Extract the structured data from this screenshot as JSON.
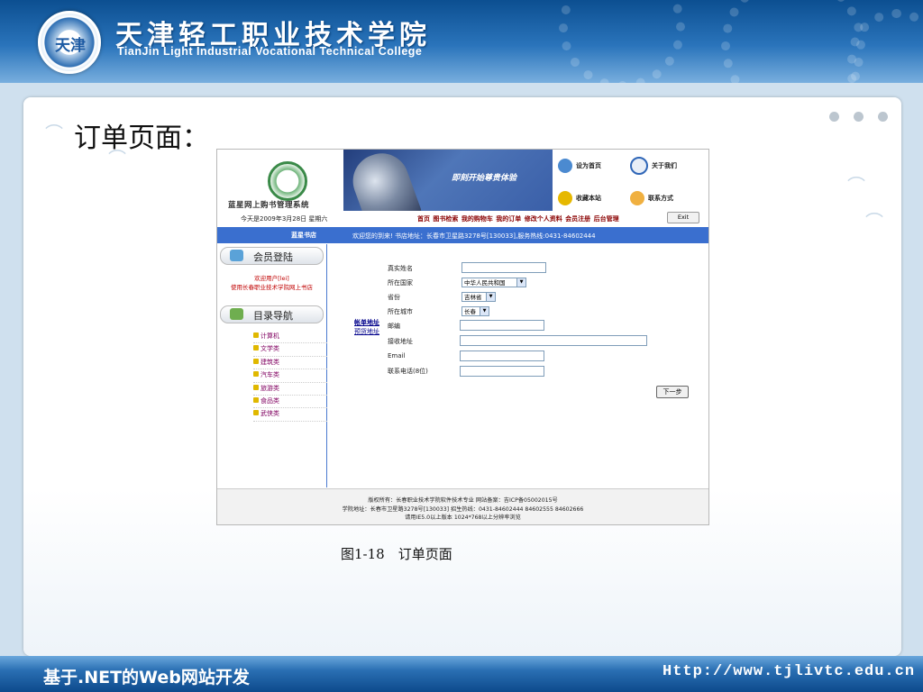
{
  "header": {
    "logo_text": "天津",
    "college_cn": "天津轻工职业技术学院",
    "college_en": "TianJin Light Industrial Vocational Technical College"
  },
  "slide": {
    "title": "订单页面：",
    "caption": "图1-18　订单页面"
  },
  "site": {
    "system_name": "蓝星网上购书管理系统",
    "banner_slogan": "即刻开始尊贵体验",
    "quick_links": [
      "设为首页",
      "关于我们",
      "收藏本站",
      "联系方式"
    ],
    "date_text": "今天是2009年3月28日 星期六",
    "menu_text": "首页 图书检索 我的购物车 我的订单 修改个人资料 会员注册 后台管理",
    "exit_label": "Exit",
    "shop_name": "蓝星书店",
    "welcome_text": "欢迎您的到来! 书店地址：长春市卫星路3278号[130033],服务热线:0431-84602444",
    "sidebar": {
      "login_title": "会员登陆",
      "member_line1": "欢迎用户[lei]",
      "member_line2": "使用长春职业技术学院网上书店",
      "nav_title": "目录导航",
      "categories": [
        "计算机",
        "文学类",
        "建筑类",
        "汽车类",
        "旅游类",
        "食品类",
        "武侠类"
      ]
    },
    "form": {
      "link_billing": "帐单地址",
      "link_shipping": "预货地址",
      "labels": [
        "真实姓名",
        "所在国家",
        "省份",
        "所在城市",
        "邮编",
        "接收地址",
        "Email",
        "联系电话(8位)"
      ],
      "country_value": "中华人民共和国",
      "province_value": "吉林省",
      "city_value": "长春",
      "next_button": "下一步"
    },
    "footer": {
      "line1": "版权所有：长春职业技术学院软件技术专业  网站备案：吉ICP备05002015号",
      "line2": "学院地址：长春市卫星路3278号[130033] 招生热线：0431-84602444 84602555 84602666",
      "line3": "请用IE5.0以上版本  1024*768以上分辨率浏览"
    }
  },
  "footer": {
    "course": "基于.NET的Web网站开发",
    "url": "Http://www.tjlivtc.edu.cn"
  }
}
